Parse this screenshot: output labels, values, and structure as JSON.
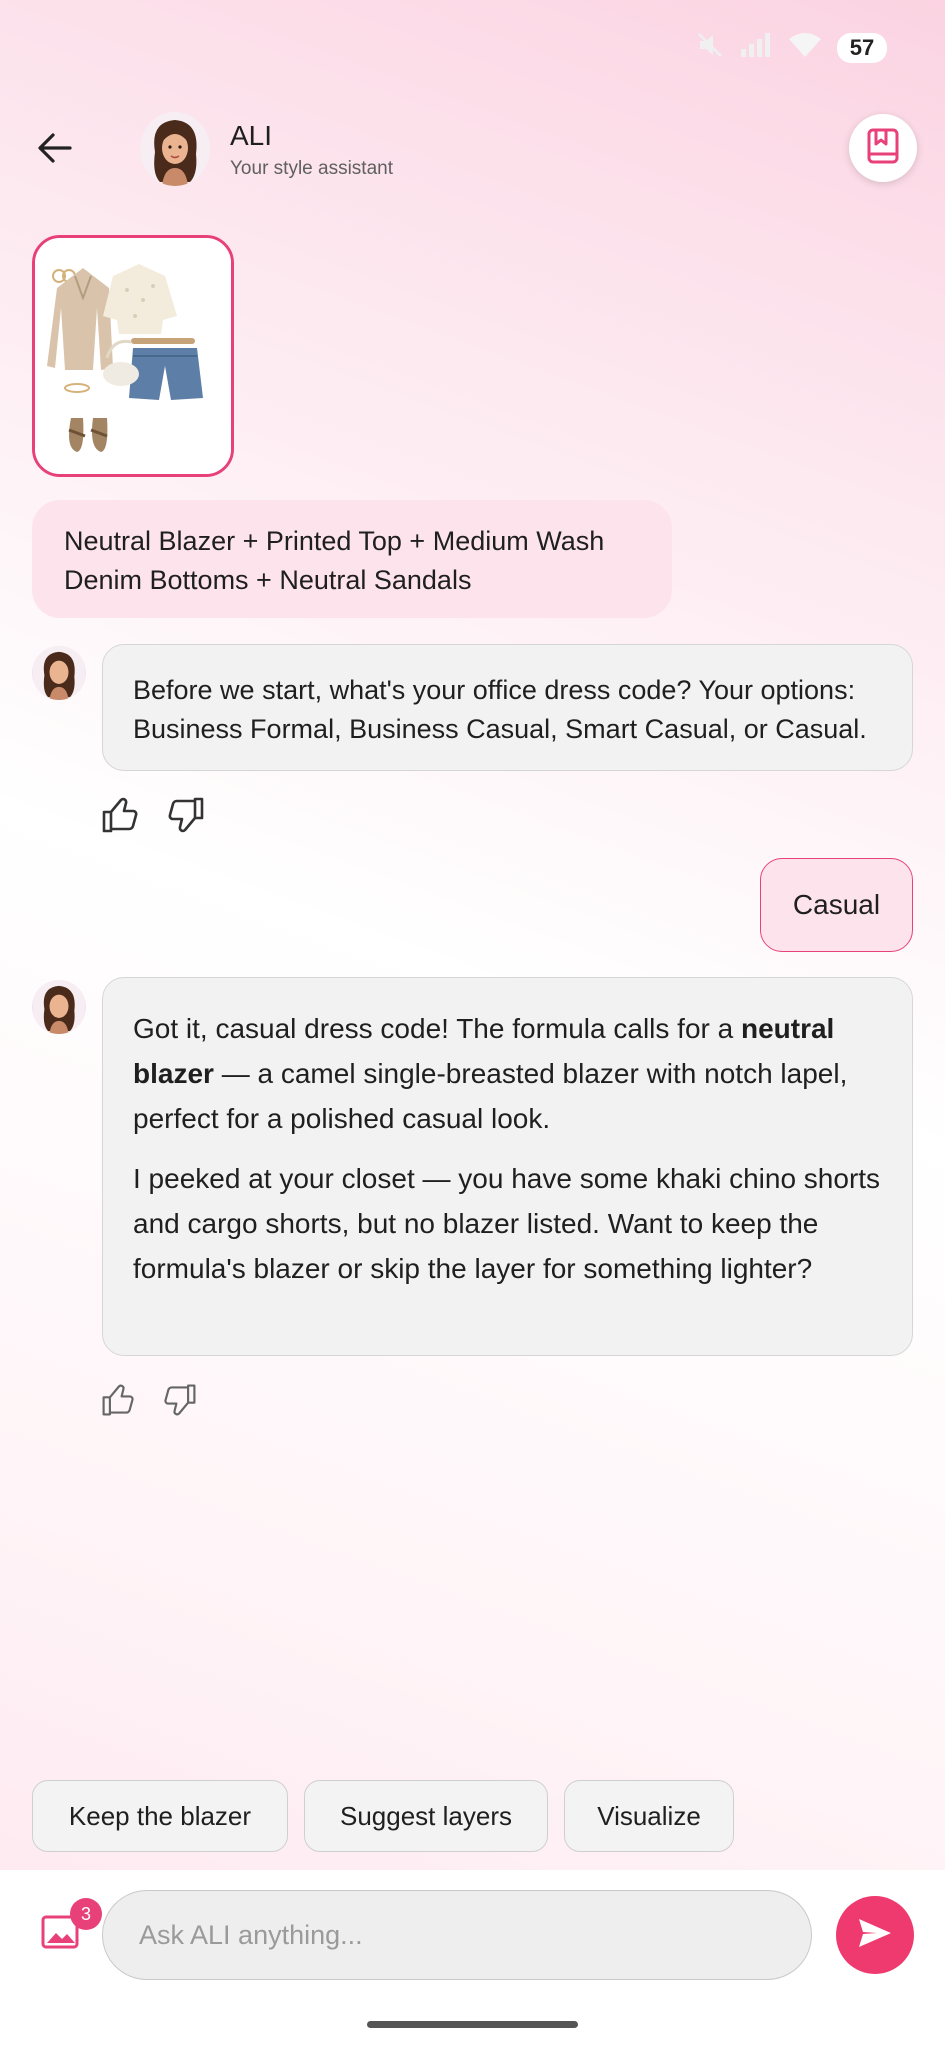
{
  "status_bar": {
    "battery": "57"
  },
  "header": {
    "title": "ALI",
    "subtitle": "Your style assistant"
  },
  "outfit_formula": "Neutral Blazer + Printed Top + Medium Wash Denim Bottoms + Neutral Sandals",
  "messages": [
    {
      "role": "assistant",
      "text": "Before we start, what's your office dress code? Your options: Business Formal, Business Casual, Smart Casual, or Casual."
    },
    {
      "role": "user",
      "text": "Casual"
    },
    {
      "role": "assistant",
      "p1_before": "Got it, casual dress code! The formula calls for a ",
      "p1_bold": "neutral blazer",
      "p1_after": " — a camel single-breasted blazer with notch lapel, perfect for a polished casual look.",
      "p2": "I peeked at your closet — you have some khaki chino shorts and cargo shorts, but no blazer listed. Want to keep the formula's blazer or skip the layer for something lighter?"
    }
  ],
  "suggestions": [
    "Keep the blazer",
    "Suggest layers",
    "Visualize"
  ],
  "input": {
    "placeholder": "Ask ALI anything...",
    "value": "",
    "attachments_badge": "3"
  },
  "colors": {
    "accent": "#e8417a",
    "send": "#ef3a6f",
    "user_bubble": "#fde4ec",
    "bot_bubble": "#f2f2f3"
  },
  "icons": {
    "back": "arrow-left-icon",
    "bookmark": "bookmark-book-icon",
    "like": "thumbs-up-icon",
    "dislike": "thumbs-down-icon",
    "gallery": "image-icon",
    "send": "send-icon"
  }
}
